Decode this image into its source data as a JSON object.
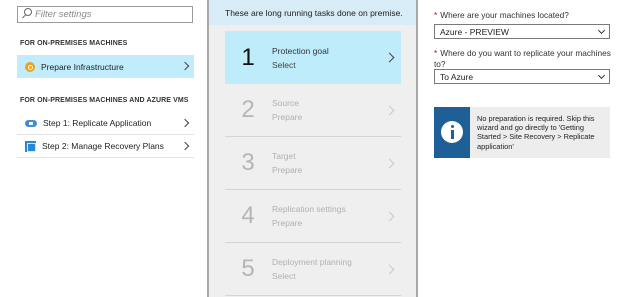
{
  "left": {
    "filter_placeholder": "Filter settings",
    "section1_title": "FOR ON-PREMISES MACHINES",
    "section2_title": "FOR ON-PREMISES MACHINES AND AZURE VMS",
    "items": [
      {
        "label": "Prepare Infrastructure",
        "icon": "prepare-infrastructure-icon",
        "selected": true
      },
      {
        "label": "Step 1: Replicate Application",
        "icon": "cloud-replicate-icon",
        "selected": false
      },
      {
        "label": "Step 2: Manage Recovery Plans",
        "icon": "recovery-plan-icon",
        "selected": false
      }
    ]
  },
  "middle": {
    "header": "These are long running tasks done on premise.",
    "steps": [
      {
        "num": "1",
        "title": "Protection goal",
        "status": "Select",
        "active": true
      },
      {
        "num": "2",
        "title": "Source",
        "status": "Prepare",
        "active": false
      },
      {
        "num": "3",
        "title": "Target",
        "status": "Prepare",
        "active": false
      },
      {
        "num": "4",
        "title": "Replication settings",
        "status": "Prepare",
        "active": false
      },
      {
        "num": "5",
        "title": "Deployment planning",
        "status": "Select",
        "active": false
      }
    ]
  },
  "right": {
    "required_mark": "*",
    "q1_label": "Where are your machines located?",
    "q1_value": "Azure - PREVIEW",
    "q2_label": "Where do you want to replicate your machines to?",
    "q2_value": "To Azure",
    "info_text": "No preparation is required. Skip this wizard and go directly to 'Getting Started > Site Recovery > Replicate application'"
  },
  "colors": {
    "selected_bg": "#c0ecfc",
    "header_bg": "#d7ecf6",
    "info_icon_bg": "#1d5f96",
    "required_star": "#d0021b"
  }
}
